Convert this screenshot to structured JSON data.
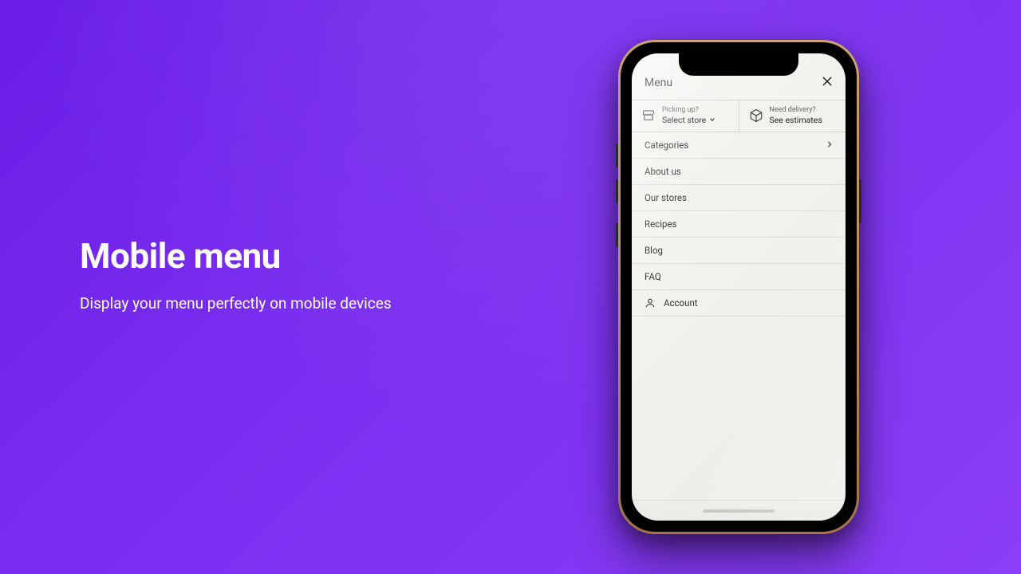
{
  "hero": {
    "title": "Mobile menu",
    "subtitle": "Display your menu perfectly on mobile devices"
  },
  "phone": {
    "menu_title": "Menu",
    "pickup": {
      "label_small": "Picking up?",
      "label_big": "Select store"
    },
    "delivery": {
      "label_small": "Need delivery?",
      "label_big": "See estimates"
    },
    "items": [
      {
        "label": "Categories",
        "has_chevron": true
      },
      {
        "label": "About us",
        "has_chevron": false
      },
      {
        "label": "Our stores",
        "has_chevron": false
      },
      {
        "label": "Recipes",
        "has_chevron": false
      },
      {
        "label": "Blog",
        "has_chevron": false
      },
      {
        "label": "FAQ",
        "has_chevron": false
      }
    ],
    "account_label": "Account"
  }
}
